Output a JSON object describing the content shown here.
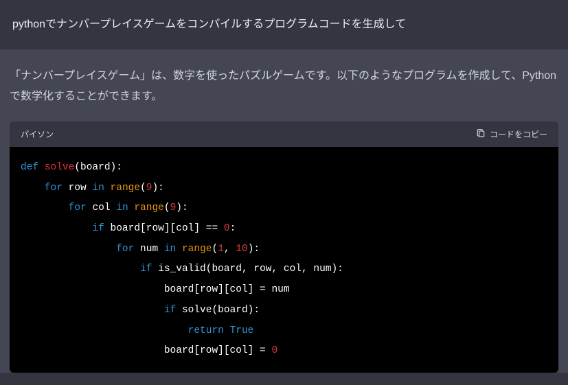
{
  "user_prompt": "pythonでナンバープレイスゲームをコンパイルするプログラムコードを生成して",
  "assistant_intro": "「ナンバープレイスゲーム」は、数字を使ったパズルゲームです。以下のようなプログラムを作成して、Pythonで数学化することができます。",
  "code_header": {
    "language": "パイソン",
    "copy_label": "コードをコピー"
  },
  "code_tokens": [
    [
      [
        "kw-def",
        "def"
      ],
      [
        "punct",
        " "
      ],
      [
        "fn-name",
        "solve"
      ],
      [
        "punct",
        "(board):"
      ]
    ],
    [
      [
        "punct",
        "    "
      ],
      [
        "kw-flow",
        "for"
      ],
      [
        "punct",
        " "
      ],
      [
        "ident",
        "row"
      ],
      [
        "punct",
        " "
      ],
      [
        "kw-in",
        "in"
      ],
      [
        "punct",
        " "
      ],
      [
        "fn-call",
        "range"
      ],
      [
        "punct",
        "("
      ],
      [
        "num",
        "9"
      ],
      [
        "punct",
        "):"
      ]
    ],
    [
      [
        "punct",
        "        "
      ],
      [
        "kw-flow",
        "for"
      ],
      [
        "punct",
        " "
      ],
      [
        "ident",
        "col"
      ],
      [
        "punct",
        " "
      ],
      [
        "kw-in",
        "in"
      ],
      [
        "punct",
        " "
      ],
      [
        "fn-call",
        "range"
      ],
      [
        "punct",
        "("
      ],
      [
        "num",
        "9"
      ],
      [
        "punct",
        "):"
      ]
    ],
    [
      [
        "punct",
        "            "
      ],
      [
        "kw-flow",
        "if"
      ],
      [
        "punct",
        " board[row][col] == "
      ],
      [
        "num",
        "0"
      ],
      [
        "punct",
        ":"
      ]
    ],
    [
      [
        "punct",
        "                "
      ],
      [
        "kw-flow",
        "for"
      ],
      [
        "punct",
        " "
      ],
      [
        "ident",
        "num"
      ],
      [
        "punct",
        " "
      ],
      [
        "kw-in",
        "in"
      ],
      [
        "punct",
        " "
      ],
      [
        "fn-call",
        "range"
      ],
      [
        "punct",
        "("
      ],
      [
        "num",
        "1"
      ],
      [
        "punct",
        ", "
      ],
      [
        "num",
        "10"
      ],
      [
        "punct",
        "):"
      ]
    ],
    [
      [
        "punct",
        "                    "
      ],
      [
        "kw-flow",
        "if"
      ],
      [
        "punct",
        " is_valid(board, row, col, num):"
      ]
    ],
    [
      [
        "punct",
        "                        board[row][col] = num"
      ]
    ],
    [
      [
        "punct",
        "                        "
      ],
      [
        "kw-flow",
        "if"
      ],
      [
        "punct",
        " solve(board):"
      ]
    ],
    [
      [
        "punct",
        "                            "
      ],
      [
        "kw-return",
        "return"
      ],
      [
        "punct",
        " "
      ],
      [
        "bool",
        "True"
      ]
    ],
    [
      [
        "punct",
        "                        board[row][col] = "
      ],
      [
        "num",
        "0"
      ]
    ]
  ]
}
